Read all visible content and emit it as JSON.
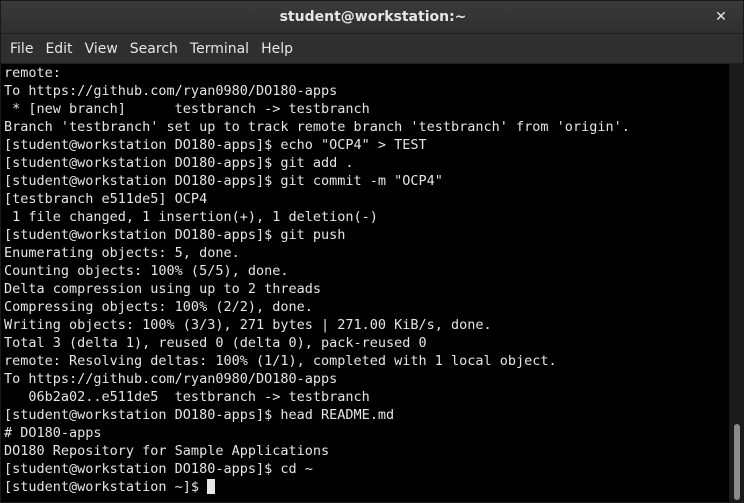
{
  "window": {
    "title": "student@workstation:~",
    "close_glyph": "✕"
  },
  "menu": {
    "items": [
      "File",
      "Edit",
      "View",
      "Search",
      "Terminal",
      "Help"
    ]
  },
  "terminal": {
    "lines": [
      "remote:",
      "To https://github.com/ryan0980/DO180-apps",
      " * [new branch]      testbranch -> testbranch",
      "Branch 'testbranch' set up to track remote branch 'testbranch' from 'origin'.",
      "[student@workstation DO180-apps]$ echo \"OCP4\" > TEST",
      "[student@workstation DO180-apps]$ git add .",
      "[student@workstation DO180-apps]$ git commit -m \"OCP4\"",
      "[testbranch e511de5] OCP4",
      " 1 file changed, 1 insertion(+), 1 deletion(-)",
      "[student@workstation DO180-apps]$ git push",
      "Enumerating objects: 5, done.",
      "Counting objects: 100% (5/5), done.",
      "Delta compression using up to 2 threads",
      "Compressing objects: 100% (2/2), done.",
      "Writing objects: 100% (3/3), 271 bytes | 271.00 KiB/s, done.",
      "Total 3 (delta 1), reused 0 (delta 0), pack-reused 0",
      "remote: Resolving deltas: 100% (1/1), completed with 1 local object.",
      "To https://github.com/ryan0980/DO180-apps",
      "   06b2a02..e511de5  testbranch -> testbranch",
      "[student@workstation DO180-apps]$ head README.md",
      "# DO180-apps",
      "DO180 Repository for Sample Applications",
      "[student@workstation DO180-apps]$ cd ~"
    ],
    "prompt": "[student@workstation ~]$ "
  },
  "colors": {
    "terminal_bg": "#000000",
    "terminal_fg": "#e5e5e5",
    "chrome_bg": "#2f2f2f"
  }
}
